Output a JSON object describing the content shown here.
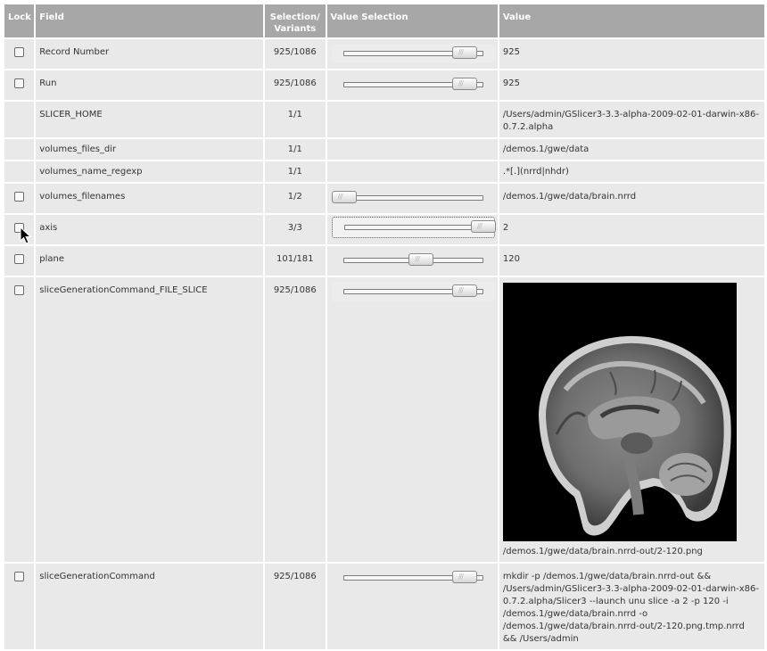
{
  "headers": {
    "lock": "Lock",
    "field": "Field",
    "selection": "Selection/\nVariants",
    "value_selection": "Value Selection",
    "value": "Value"
  },
  "rows": [
    {
      "field": "Record Number",
      "selection": "925/1086",
      "value": "925",
      "has_lock": true,
      "slider": 0.86
    },
    {
      "field": "Run",
      "selection": "925/1086",
      "value": "925",
      "has_lock": true,
      "slider": 0.86
    },
    {
      "field": "SLICER_HOME",
      "selection": "1/1",
      "value": "/Users/admin/GSlicer3-3.3-alpha-2009-02-01-darwin-x86-0.7.2.alpha",
      "has_lock": false,
      "slider": null
    },
    {
      "field": "volumes_files_dir",
      "selection": "1/1",
      "value": "/demos.1/gwe/data",
      "has_lock": false,
      "slider": null
    },
    {
      "field": "volumes_name_regexp",
      "selection": "1/1",
      "value": ".*[.](nrrd|nhdr)",
      "has_lock": false,
      "slider": null
    },
    {
      "field": "volumes_filenames",
      "selection": "1/2",
      "value": "/demos.1/gwe/data/brain.nrrd",
      "has_lock": true,
      "slider": 0.0
    },
    {
      "field": "axis",
      "selection": "3/3",
      "value": "2",
      "has_lock": true,
      "slider": 1.0
    },
    {
      "field": "plane",
      "selection": "101/181",
      "value": "120",
      "has_lock": true,
      "slider": 0.55
    },
    {
      "field": "sliceGenerationCommand_FILE_SLICE",
      "selection": "925/1086",
      "value": "/demos.1/gwe/data/brain.nrrd-out/2-120.png",
      "has_lock": true,
      "slider": 0.86
    },
    {
      "field": "sliceGenerationCommand",
      "selection": "925/1086",
      "value": "mkdir -p /demos.1/gwe/data/brain.nrrd-out && /Users/admin/GSlicer3-3.3-alpha-2009-02-01-darwin-x86-0.7.2.alpha/Slicer3 --launch unu slice -a 2 -p 120 -i /demos.1/gwe/data/brain.nrrd -o /demos.1/gwe/data/brain.nrrd-out/2-120.png.tmp.nrrd && /Users/admin",
      "has_lock": true,
      "slider": 0.86
    }
  ],
  "colors": {
    "header_bg": "#a7a7a7",
    "cell_bg": "#e9e9e9"
  },
  "icons": {
    "lock": "checkbox-icon",
    "cursor": "mouse-pointer-icon",
    "image": "mri-brain-slice-image"
  }
}
